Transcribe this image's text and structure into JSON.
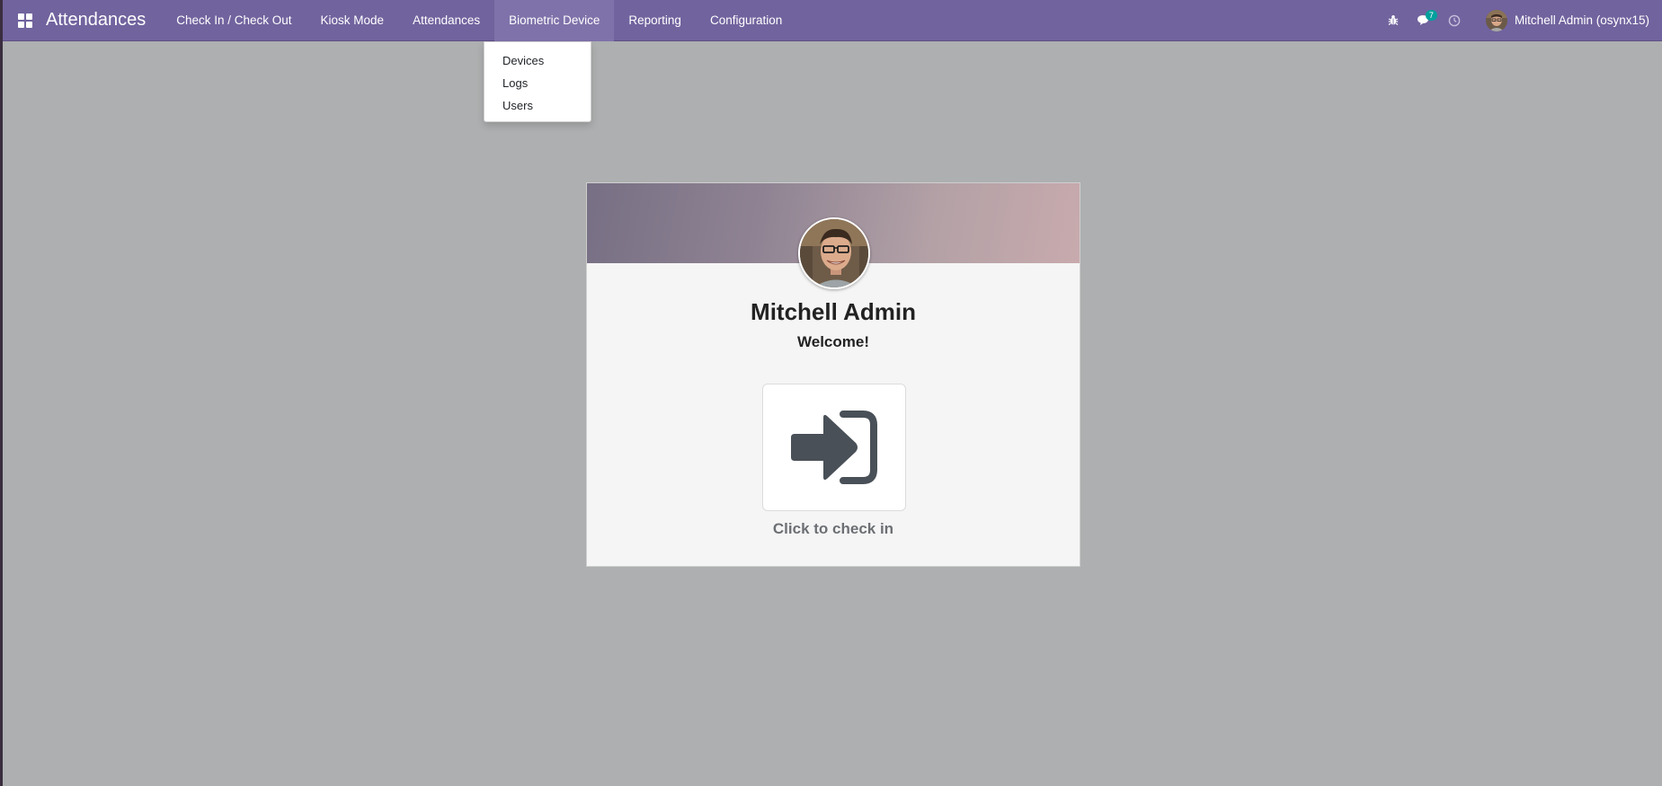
{
  "navbar": {
    "app_title": "Attendances",
    "menu": [
      {
        "label": "Check In / Check Out"
      },
      {
        "label": "Kiosk Mode"
      },
      {
        "label": "Attendances"
      },
      {
        "label": "Biometric Device"
      },
      {
        "label": "Reporting"
      },
      {
        "label": "Configuration"
      }
    ],
    "active_menu": "Biometric Device",
    "icons": [
      "apps-grid-icon",
      "bug-icon",
      "chat-icon",
      "clock-icon"
    ],
    "messages_badge": "7",
    "user_name": "Mitchell Admin (osynx15)"
  },
  "dropdown": {
    "items": [
      {
        "label": "Devices"
      },
      {
        "label": "Logs"
      },
      {
        "label": "Users"
      }
    ]
  },
  "card": {
    "employee_name": "Mitchell Admin",
    "welcome": "Welcome!",
    "checkin_icon": "sign-in-icon",
    "checkin_label": "Click to check in"
  },
  "colors": {
    "navbar": "#71639e",
    "navbar_active": "#7f72aa",
    "background": "#adafb0",
    "badge": "#00a09d",
    "checkin_icon": "#495057"
  }
}
